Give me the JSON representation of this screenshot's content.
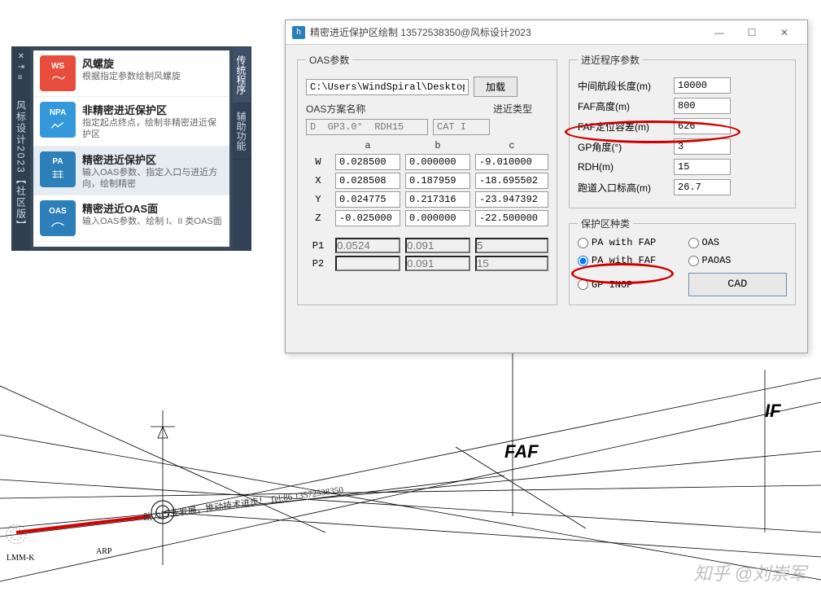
{
  "palette": {
    "title": "风标设计2023【社区版】",
    "tabs": {
      "main": "传统程序",
      "aux": "辅助功能"
    },
    "items": [
      {
        "badge": "WS",
        "title": "风螺旋",
        "desc": "根据指定参数绘制风螺旋"
      },
      {
        "badge": "NPA",
        "title": "非精密进近保护区",
        "desc": "指定起点终点，绘制非精密进近保护区"
      },
      {
        "badge": "PA",
        "title": "精密进近保护区",
        "desc": "输入OAS参数、指定入口与进近方向，绘制精密"
      },
      {
        "badge": "OAS",
        "title": "精密进近OAS面",
        "desc": "输入OAS参数、绘制 I、II 类OAS面"
      }
    ]
  },
  "dialog": {
    "title": "精密进近保护区绘制     13572538350@风标设计2023",
    "oas": {
      "legend": "OAS参数",
      "path": "C:\\Users\\WindSpiral\\Desktop\\…",
      "load": "加载",
      "scheme_label": "OAS方案名称",
      "type_label": "进近类型",
      "scheme": "D  GP3.0°  RDH15",
      "type": "CAT I",
      "hdr": {
        "a": "a",
        "b": "b",
        "c": "c"
      },
      "rows": [
        {
          "k": "W",
          "a": "0.028500",
          "b": "0.000000",
          "c": "-9.010000"
        },
        {
          "k": "X",
          "a": "0.028508",
          "b": "0.187959",
          "c": "-18.695502"
        },
        {
          "k": "Y",
          "a": "0.024775",
          "b": "0.217316",
          "c": "-23.947392"
        },
        {
          "k": "Z",
          "a": "-0.025000",
          "b": "0.000000",
          "c": "-22.500000"
        }
      ],
      "p1": {
        "k": "P1",
        "a": "0.0524",
        "b": "0.091",
        "c": "5"
      },
      "p2": {
        "k": "P2",
        "a": "",
        "b": "0.091",
        "c": "15"
      }
    },
    "proc": {
      "legend": "进近程序参数",
      "params": [
        {
          "label": "中间航段长度(m)",
          "value": "10000"
        },
        {
          "label": "FAF高度(m)",
          "value": "800"
        },
        {
          "label": "FAF定位容差(m)",
          "value": "626"
        },
        {
          "label": "GP角度(°)",
          "value": "3"
        },
        {
          "label": "RDH(m)",
          "value": "15"
        },
        {
          "label": "跑道入口标高(m)",
          "value": "26.7"
        }
      ]
    },
    "zone": {
      "legend": "保护区种类",
      "opts": {
        "pa_fap": "PA with FAP",
        "oas": "OAS",
        "pa_faf": "PA with FAF",
        "paoas": "PAOAS",
        "gp": "GP INOP"
      },
      "cad": "CAD"
    }
  },
  "cad": {
    "faf": "FAF",
    "if": "IF",
    "arp": "ARP",
    "lmm": "LMM-K",
    "note": "助力行业发展，推动技术进步！ Tel:86 13572538350"
  },
  "watermark": "知乎 @刘崇军"
}
